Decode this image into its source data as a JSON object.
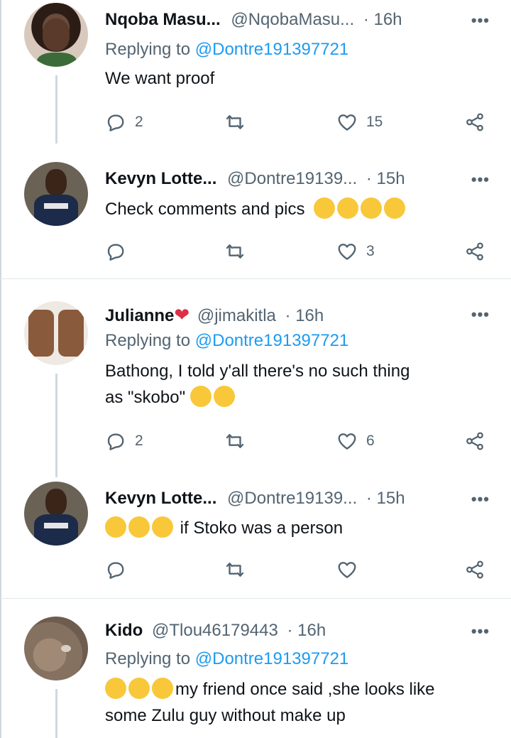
{
  "tweets": [
    {
      "name": "Nqoba Masu...",
      "handle": "@NqobaMasu...",
      "time": "· 16h",
      "replying_label": "Replying to",
      "replying_to": "@Dontre191397721",
      "text": "We want proof",
      "replies": "2",
      "likes": "15"
    },
    {
      "name": "Kevyn Lotte...",
      "handle": "@Dontre19139...",
      "time": "· 15h",
      "text": "Check comments and pics",
      "replies": "",
      "likes": "3"
    },
    {
      "name": "Julianne",
      "handle": "@jimakitla",
      "time": "· 16h",
      "replying_label": "Replying to",
      "replying_to": "@Dontre191397721",
      "text_line1": "Bathong, I told y'all there's no such thing",
      "text_line2": "as \"skobo\"",
      "replies": "2",
      "likes": "6"
    },
    {
      "name": "Kevyn Lotte...",
      "handle": "@Dontre19139...",
      "time": "· 15h",
      "text": "if Stoko was a person",
      "replies": "",
      "likes": ""
    },
    {
      "name": "Kido",
      "handle": "@Tlou46179443",
      "time": "· 16h",
      "replying_label": "Replying to",
      "replying_to": "@Dontre191397721",
      "text_line1": "my friend once said ,she looks like",
      "text_line2": "some Zulu guy without make up"
    }
  ],
  "more_label": "•••",
  "colors": {
    "accent": "#1d9bf0",
    "muted": "#536471",
    "heart_emoji": "#e0245e"
  },
  "icons": [
    "reply-icon",
    "retweet-icon",
    "like-icon",
    "share-icon",
    "more-icon",
    "emoji"
  ]
}
